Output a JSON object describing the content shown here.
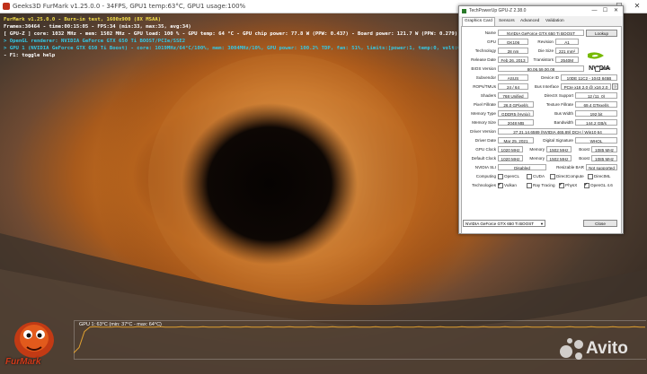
{
  "window": {
    "title": "Geeks3D FurMark v1.25.0.0 - 34FPS, GPU1 temp:63°C, GPU1 usage:100%",
    "minimize": "—",
    "maximize": "☐",
    "close": "✕"
  },
  "overlay": {
    "line1": "FurMark v1.25.0.0 - Burn-in test, 1600x900 (8X MSAA)",
    "line2": "Frames:30464 - time:00:15:05 - FPS:34 (min:33, max:35, avg:34)",
    "line3": "[ GPU-Z ] core: 1032 MHz - mem: 1502 MHz - GPU load: 100 % - GPU temp: 64 °C - GPU chip power: 77.8 W (PPW: 0.437) - Board power: 121.7 W (PPW: 0.279) - GPU voltage: 1.075 V",
    "line4": "> OpenGL renderer: NVIDIA GeForce GTX 650 Ti BOOST/PCIe/SSE2",
    "line5": "> GPU 1 (NVIDIA GeForce GTX 650 Ti Boost) - core: 1019MHz/64°C/100%, mem: 3004MHz/10%, GPU power: 100.2% TDP, fan: 51%, limits:[power:1, temp:0, volt:0, OV:0]",
    "line6": "- F1: toggle help",
    "colors": {
      "line1": "#f5e04a",
      "line2": "#ffffff",
      "line3": "#ffffff",
      "line4": "#33c9e8",
      "line5": "#33c9e8",
      "line6": "#ffffff"
    }
  },
  "graph": {
    "label": "GPU 1: 63°C (min: 37°C - max: 64°C)",
    "temperature_series": {
      "name": "GPU 1",
      "min_c": 37,
      "max_c": 64,
      "current_c": 63,
      "line_color": "#e0a030"
    }
  },
  "branding": {
    "furmark_logo": "FurMark",
    "watermark": "Avito"
  },
  "gpuz": {
    "title": "TechPowerUp GPU-Z 2.38.0",
    "tabs": [
      "Graphics Card",
      "Sensors",
      "Advanced",
      "Validation"
    ],
    "active_tab": "Graphics Card",
    "fields": {
      "name_label": "Name",
      "name": "NVIDIA GeForce GTX 650 Ti BOOST",
      "lookup": "Lookup",
      "gpu_label": "GPU",
      "gpu": "GK106",
      "revision_label": "Revision",
      "revision": "A1",
      "tech_label": "Technology",
      "tech": "28 nm",
      "diesize_label": "Die Size",
      "diesize": "221 mm²",
      "release_label": "Release Date",
      "release": "Feb 26, 2013",
      "transistors_label": "Transistors",
      "transistors": "2540M",
      "bios_label": "BIOS Version",
      "bios": "80.06.59.00.08",
      "uefi": "UEFI",
      "subvendor_label": "Subvendor",
      "subvendor": "ASUS",
      "deviceid_label": "Device ID",
      "deviceid": "10DE 11C2 - 1043 845B",
      "rops_label": "ROPs/TMUs",
      "rops": "24 / 64",
      "bus_label": "Bus Interface",
      "bus": "PCIe x16 2.0 @ x16 2.0",
      "shaders_label": "Shaders",
      "shaders": "768 Unified",
      "directx_label": "DirectX Support",
      "directx": "12 (11_0)",
      "pixel_label": "Pixel Fillrate",
      "pixel": "26.0 GPixel/s",
      "texture_label": "Texture Fillrate",
      "texture": "69.4 GTexel/s",
      "memtype_label": "Memory Type",
      "memtype": "GDDR5 (Hynix)",
      "buswidth_label": "Bus Width",
      "buswidth": "192 bit",
      "memsize_label": "Memory Size",
      "memsize": "2048 MB",
      "bandwidth_label": "Bandwidth",
      "bandwidth": "144.2 GB/s",
      "driverver_label": "Driver Version",
      "driverver": "27.21.14.6589 (NVIDIA 465.89) DCH / Win10 64",
      "driverdate_label": "Driver Date",
      "driverdate": "Mar 25, 2021",
      "digsig_label": "Digital Signature",
      "digsig": "WHQL",
      "gpuclock_label": "GPU Clock",
      "gpuclock": "1020 MHz",
      "mem1_label": "Memory",
      "mem1": "1502 MHz",
      "boost1_label": "Boost",
      "boost1": "1085 MHz",
      "defclock_label": "Default Clock",
      "defclock": "1020 MHz",
      "mem2_label": "Memory",
      "mem2": "1502 MHz",
      "boost2_label": "Boost",
      "boost2": "1085 MHz",
      "sli_label": "NVIDIA SLI",
      "sli": "Disabled",
      "rbar_label": "Resizable BAR",
      "rbar": "Not supported",
      "computing_label": "Computing",
      "technologies_label": "Technologies"
    },
    "computing": [
      {
        "name": "OpenCL",
        "checked": false
      },
      {
        "name": "CUDA",
        "checked": false
      },
      {
        "name": "DirectCompute",
        "checked": false
      },
      {
        "name": "DirectML",
        "checked": false
      }
    ],
    "technologies": [
      {
        "name": "Vulkan",
        "checked": true
      },
      {
        "name": "Ray Tracing",
        "checked": false
      },
      {
        "name": "PhysX",
        "checked": true
      },
      {
        "name": "OpenGL 4.6",
        "checked": true
      }
    ],
    "selected_gpu": "NVIDIA GeForce GTX 650 Ti BOOST",
    "close_label": "Close",
    "vendor_logo": "NVIDIA",
    "accent": "#76b900"
  }
}
